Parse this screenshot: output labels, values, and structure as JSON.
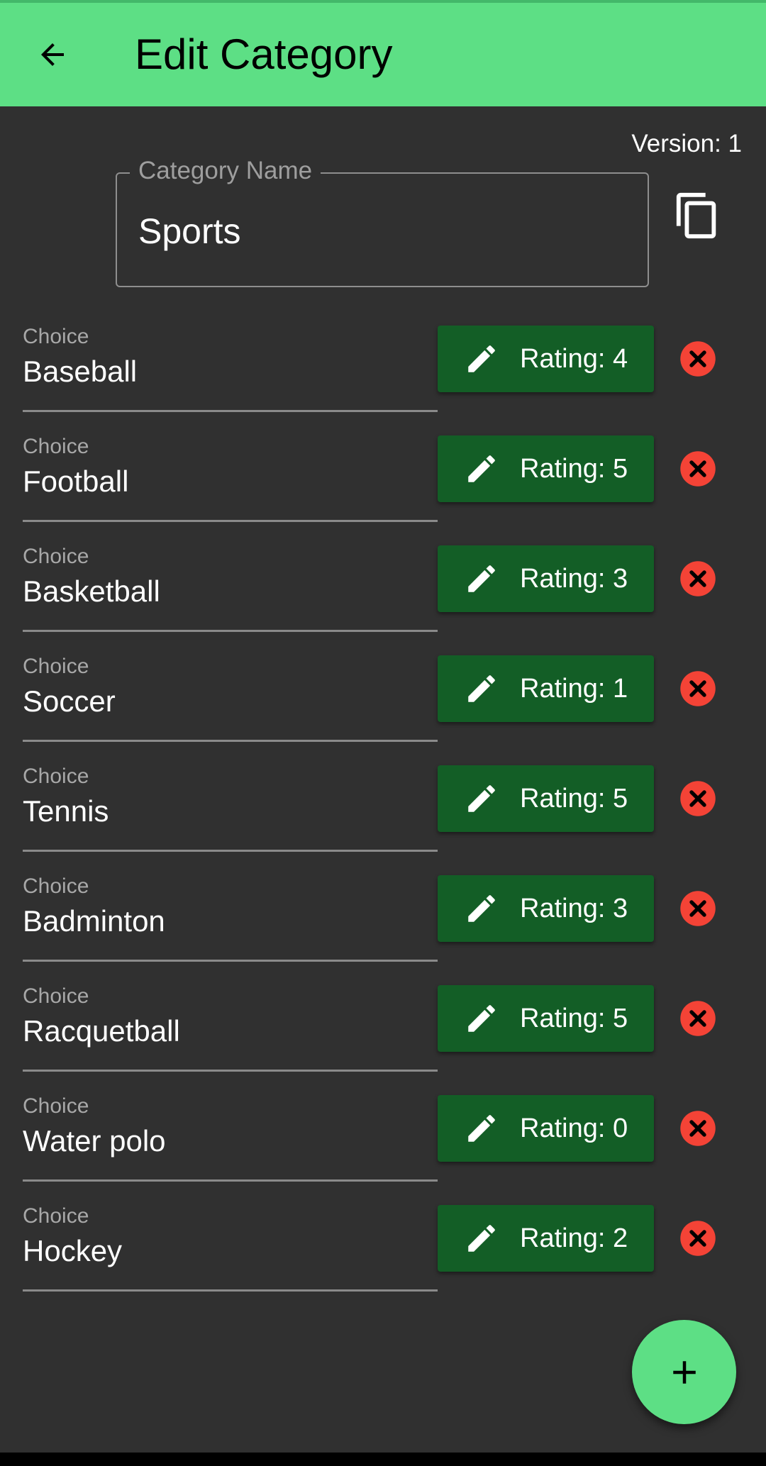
{
  "appbar": {
    "title": "Edit Category",
    "back_icon": "arrow-left-icon",
    "bg_color": "#5ddf85"
  },
  "version_text": "Version: 1",
  "category_field": {
    "label": "Category Name",
    "value": "Sports"
  },
  "copy_icon": "copy-icon",
  "choice_label": "Choice",
  "choices": [
    {
      "label": "Choice",
      "name": "Baseball",
      "rating": "Rating: 4"
    },
    {
      "label": "Choice",
      "name": "Football",
      "rating": "Rating: 5"
    },
    {
      "label": "Choice",
      "name": "Basketball",
      "rating": "Rating: 3"
    },
    {
      "label": "Choice",
      "name": "Soccer",
      "rating": "Rating: 1"
    },
    {
      "label": "Choice",
      "name": "Tennis",
      "rating": "Rating: 5"
    },
    {
      "label": "Choice",
      "name": "Badminton",
      "rating": "Rating: 3"
    },
    {
      "label": "Choice",
      "name": "Racquetball",
      "rating": "Rating: 5"
    },
    {
      "label": "Choice",
      "name": "Water polo",
      "rating": "Rating: 0"
    },
    {
      "label": "Choice",
      "name": "Hockey",
      "rating": "Rating: 2"
    }
  ],
  "rating_button_color": "#135e26",
  "delete_icon_color": "#f44336",
  "fab_icon": "plus-icon"
}
